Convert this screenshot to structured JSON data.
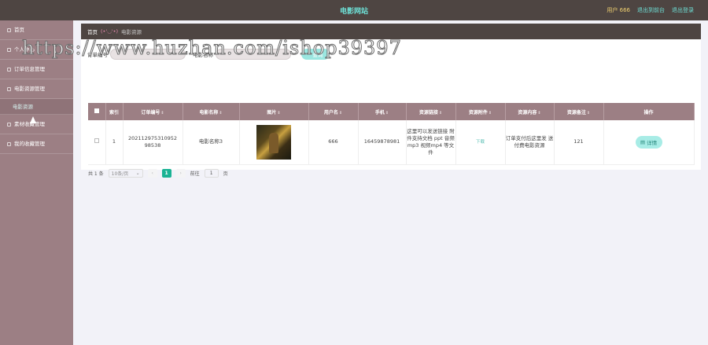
{
  "header": {
    "site_title": "电影网站",
    "user_label": "用户 666",
    "back_to_console": "退出到前台",
    "logout": "退出登录"
  },
  "sidebar": {
    "items": [
      {
        "label": "首页"
      },
      {
        "label": "个人中心"
      },
      {
        "label": "订单信息管理"
      },
      {
        "label": "电影资源管理"
      },
      {
        "label": "电影资源"
      },
      {
        "label": "素材收藏管理"
      },
      {
        "label": "我的收藏管理"
      }
    ]
  },
  "breadcrumb": {
    "home": "首页",
    "sep": "(•'◡'•)",
    "current": "电影资源"
  },
  "search": {
    "label_order_no": "订单编号",
    "label_movie_name": "电影名称",
    "button": "查询"
  },
  "table": {
    "headers": [
      "索引",
      "订单编号",
      "电影名称",
      "图片",
      "用户名",
      "手机",
      "资源链接",
      "资源附件",
      "资源内容",
      "资源备注",
      "操作"
    ],
    "rows": [
      {
        "index": "1",
        "order_no": "202112975310952 98538",
        "movie_name": "电影名称3",
        "username": "666",
        "phone": "16459878981",
        "resource_link": "这里可以发送链接 附件支持文档 ppt 音频mp3 视频mp4 等文件",
        "attachment": "下载",
        "content": "订单支付后这里发 送付费电影资源",
        "remark": "121",
        "action": "详情"
      }
    ]
  },
  "pager": {
    "total": "共 1 条",
    "page_size": "10条/页",
    "prev": "‹",
    "current_page": "1",
    "next": "›",
    "goto_label": "前往",
    "goto_value": "1",
    "page_suffix": "页"
  },
  "watermark": "https://www.huzhan.com/ishop39397",
  "colors": {
    "topbar": "#4e4542",
    "sidebar": "#9c7f84",
    "accent": "#6ee0d6",
    "pager_current": "#1ab394"
  }
}
